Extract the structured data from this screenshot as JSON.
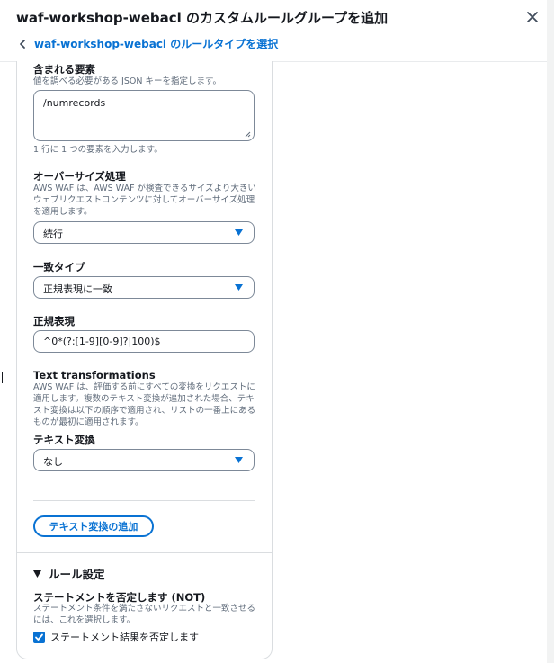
{
  "header": {
    "title": "waf-workshop-webacl のカスタムルールグループを追加",
    "back_label": "waf-workshop-webacl のルールタイプを選択"
  },
  "included_elements": {
    "label": "含まれる要素",
    "description": "値を調べる必要がある JSON キーを指定します。",
    "value": "/numrecords",
    "hint": "1 行に 1 つの要素を入力します。"
  },
  "oversize": {
    "label": "オーバーサイズ処理",
    "description": "AWS WAF は、AWS WAF が検査できるサイズより大きいウェブリクエストコンテンツに対してオーバーサイズ処理を適用します。",
    "selected": "続行"
  },
  "match_type": {
    "label": "一致タイプ",
    "selected": "正規表現に一致"
  },
  "regex": {
    "label": "正規表現",
    "value": "^0*(?:[1-9][0-9]?|100)$"
  },
  "text_transformations": {
    "heading": "Text transformations",
    "description": "AWS WAF は、評価する前にすべての変換をリクエストに適用します。複数のテキスト変換が追加された場合、テキスト変換は以下の順序で適用され、リストの一番上にあるものが最初に適用されます。",
    "label": "テキスト変換",
    "selected": "なし",
    "add_button": "テキスト変換の追加"
  },
  "rule_settings": {
    "heading": "ルール設定",
    "negate_label": "ステートメントを否定します (NOT)",
    "negate_description": "ステートメント条件を満たさないリクエストと一致させるには、これを選択します。",
    "checkbox_label": "ステートメント結果を否定します",
    "checked": true
  },
  "colors": {
    "accent": "#0972d3",
    "text": "#16191f",
    "muted": "#5f6b7a",
    "border": "#7d8998"
  }
}
